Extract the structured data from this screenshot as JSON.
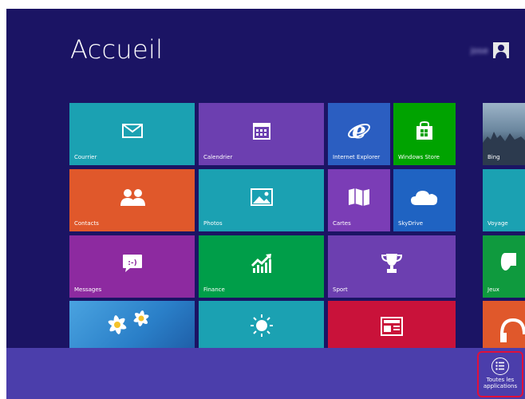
{
  "screen": {
    "title": "Accueil",
    "username": "jose"
  },
  "tiles": [
    {
      "label": "Courrier",
      "color": "#1ba1b2"
    },
    {
      "label": "Calendrier",
      "color": "#6c3fb0"
    },
    {
      "label": "Internet Explorer",
      "color": "#2b5ec1"
    },
    {
      "label": "Windows Store",
      "color": "#00a300"
    },
    {
      "label": "Bing",
      "color": "#3a5a78"
    },
    {
      "label": "Contacts",
      "color": "#e0582b"
    },
    {
      "label": "Photos",
      "color": "#1ba1b2"
    },
    {
      "label": "Cartes",
      "color": "#7b3db6"
    },
    {
      "label": "SkyDrive",
      "color": "#1f63c2"
    },
    {
      "label": "Voyage",
      "color": "#1ba1b2"
    },
    {
      "label": "Messages",
      "color": "#8d2aa0"
    },
    {
      "label": "Finance",
      "color": "#009e49"
    },
    {
      "label": "Sport",
      "color": "#6c3fb0"
    },
    {
      "label": "Jeux",
      "color": "#0f9a3e"
    }
  ],
  "all_apps": {
    "line1": "Toutes les",
    "line2": "applications"
  }
}
